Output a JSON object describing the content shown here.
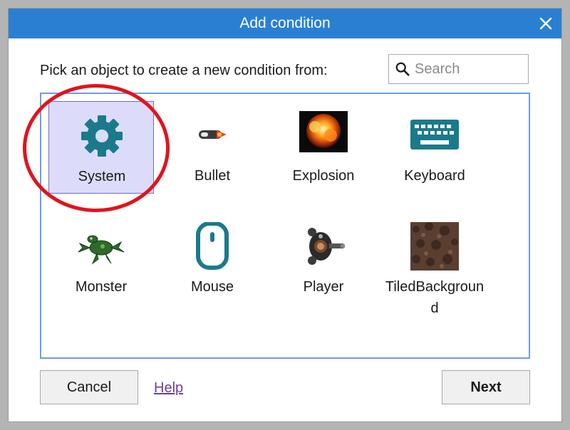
{
  "dialog": {
    "title": "Add condition",
    "prompt": "Pick an object to create a new condition from:",
    "search": {
      "placeholder": "Search",
      "value": ""
    },
    "objects": [
      {
        "label": "System",
        "icon": "gear-icon",
        "selected": true
      },
      {
        "label": "Bullet",
        "icon": "bullet-sprite"
      },
      {
        "label": "Explosion",
        "icon": "explosion-sprite"
      },
      {
        "label": "Keyboard",
        "icon": "keyboard-icon"
      },
      {
        "label": "Monster",
        "icon": "monster-sprite"
      },
      {
        "label": "Mouse",
        "icon": "mouse-icon"
      },
      {
        "label": "Player",
        "icon": "player-sprite"
      },
      {
        "label": "TiledBackground",
        "icon": "tiled-background-sprite"
      }
    ],
    "buttons": {
      "cancel": "Cancel",
      "help": "Help",
      "next": "Next"
    }
  },
  "colors": {
    "titlebar": "#2b7fd3",
    "accent_icon": "#1a7a8c",
    "annotation_ring": "#e0141c",
    "selection": "#dcdcfa"
  }
}
